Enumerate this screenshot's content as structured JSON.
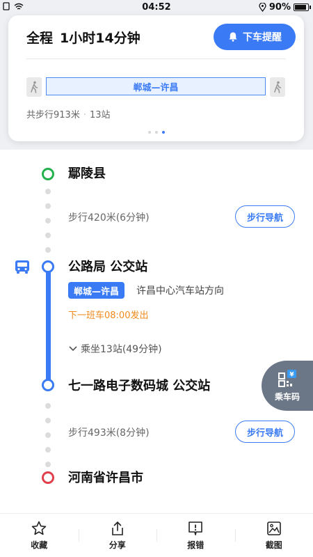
{
  "status_bar": {
    "time": "04:52",
    "battery": "90%"
  },
  "summary": {
    "total_label": "全程",
    "duration": "1小时14分钟",
    "alert_button": "下车提醒",
    "route_name": "郸城—许昌",
    "walk_total": "共步行913米",
    "stops": "13站",
    "page_indicator": {
      "count": 3,
      "active": 3
    }
  },
  "timeline": {
    "start_stop": "鄢陵县",
    "walk1": {
      "text": "步行420米(6分钟)",
      "nav_label": "步行导航"
    },
    "board_stop": "公路局 公交站",
    "line_badge": "郸城—许昌",
    "direction": "许昌中心汽车站方向",
    "next_bus": "下一班车08:00发出",
    "ride_toggle": "乘坐13站(49分钟)",
    "alight_stop": "七一路电子数码城 公交站",
    "walk2": {
      "text": "步行493米(8分钟)",
      "nav_label": "步行导航"
    },
    "end_stop": "河南省许昌市"
  },
  "ride_code": {
    "label": "乘车码"
  },
  "bottom_bar": [
    {
      "label": "收藏",
      "icon": "star-icon"
    },
    {
      "label": "分享",
      "icon": "share-icon"
    },
    {
      "label": "报错",
      "icon": "report-icon"
    },
    {
      "label": "截图",
      "icon": "screenshot-icon"
    }
  ],
  "colors": {
    "accent": "#3a7bf5",
    "start": "#22b14c",
    "end": "#e0404a",
    "next_bus": "#f08a1c"
  }
}
